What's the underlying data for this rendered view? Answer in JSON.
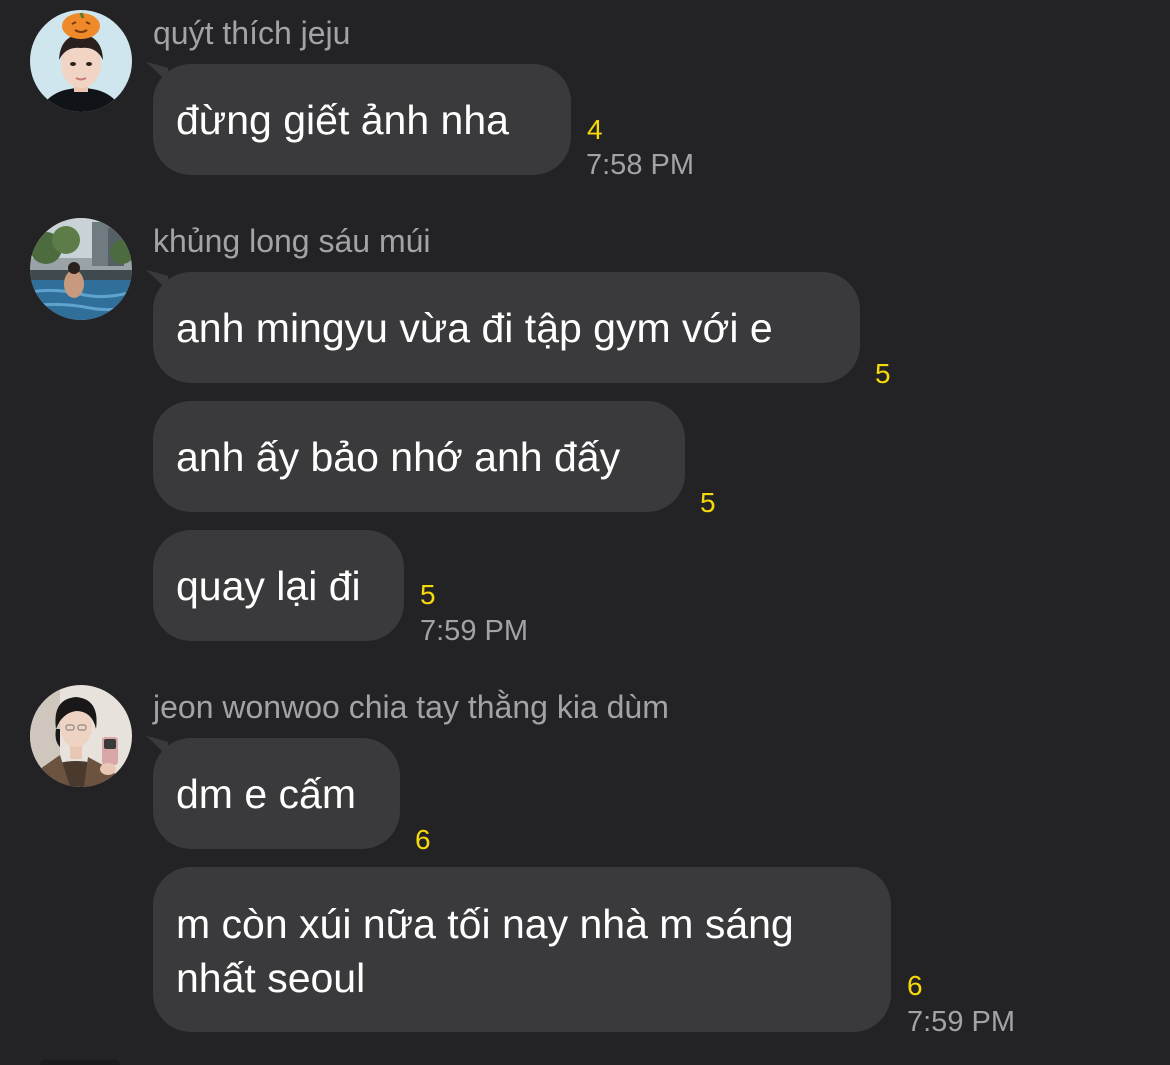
{
  "messages_group_1": {
    "sender": "quýt thích jeju",
    "avatar_icon": "profile-photo-boy-with-pumpkin-hat-icon",
    "bubbles": [
      {
        "text": "đừng giết ảnh nha",
        "count": "4"
      }
    ],
    "time": "7:58 PM"
  },
  "messages_group_2": {
    "sender": "khủng long sáu múi",
    "avatar_icon": "profile-photo-pool-icon",
    "bubbles": [
      {
        "text": "anh mingyu vừa đi tập gym với e",
        "count": "5"
      },
      {
        "text": "anh ấy bảo nhớ anh đấy",
        "count": "5"
      },
      {
        "text": "quay lại đi",
        "count": "5"
      }
    ],
    "time": "7:59 PM"
  },
  "messages_group_3": {
    "sender": "jeon wonwoo chia tay thằng kia dùm",
    "avatar_icon": "profile-photo-selfie-icon",
    "bubbles": [
      {
        "text": "dm e cấm",
        "count": "6"
      },
      {
        "text": "m còn xúi nữa tối nay nhà m sáng nhất seoul",
        "count": "6"
      }
    ],
    "time": "7:59 PM"
  },
  "colors": {
    "background": "#232325",
    "bubble": "#3a3a3c",
    "unread_count": "#f5d90a",
    "secondary_text": "#a3a3a6"
  }
}
